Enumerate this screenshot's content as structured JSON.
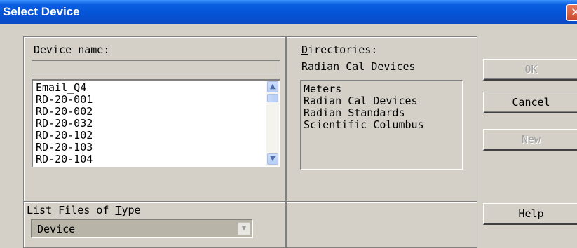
{
  "window": {
    "title": "Select Device",
    "close_glyph": "✕"
  },
  "device_name": {
    "label_pre": "",
    "label_mnemonic": "",
    "label_post": "Device name:",
    "value": "",
    "items": [
      "Email_Q4",
      "RD-20-001",
      "RD-20-002",
      "RD-20-032",
      "RD-20-102",
      "RD-20-103",
      "RD-20-104"
    ],
    "scroll_up_glyph": "▲",
    "scroll_down_glyph": "▼"
  },
  "directories": {
    "label_mnemonic": "D",
    "label_rest": "irectories:",
    "current": "Radian Cal Devices",
    "items": [
      "Meters",
      "Radian Cal Devices",
      "Radian Standards",
      "Scientific Columbus"
    ]
  },
  "file_type": {
    "label_pre": "List Files of ",
    "label_mnemonic": "T",
    "label_post": "ype",
    "selected": "Device",
    "arrow_glyph": "▼"
  },
  "buttons": {
    "ok": "OK",
    "cancel": "Cancel",
    "new": "New",
    "help": "Help"
  }
}
